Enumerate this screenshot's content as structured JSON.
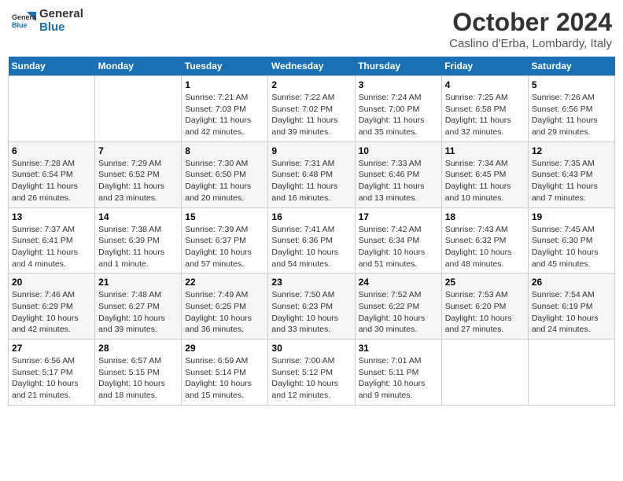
{
  "header": {
    "logo_line1": "General",
    "logo_line2": "Blue",
    "month": "October 2024",
    "location": "Caslino d'Erba, Lombardy, Italy"
  },
  "weekdays": [
    "Sunday",
    "Monday",
    "Tuesday",
    "Wednesday",
    "Thursday",
    "Friday",
    "Saturday"
  ],
  "weeks": [
    [
      {
        "day": "",
        "info": ""
      },
      {
        "day": "",
        "info": ""
      },
      {
        "day": "1",
        "info": "Sunrise: 7:21 AM\nSunset: 7:03 PM\nDaylight: 11 hours and 42 minutes."
      },
      {
        "day": "2",
        "info": "Sunrise: 7:22 AM\nSunset: 7:02 PM\nDaylight: 11 hours and 39 minutes."
      },
      {
        "day": "3",
        "info": "Sunrise: 7:24 AM\nSunset: 7:00 PM\nDaylight: 11 hours and 35 minutes."
      },
      {
        "day": "4",
        "info": "Sunrise: 7:25 AM\nSunset: 6:58 PM\nDaylight: 11 hours and 32 minutes."
      },
      {
        "day": "5",
        "info": "Sunrise: 7:26 AM\nSunset: 6:56 PM\nDaylight: 11 hours and 29 minutes."
      }
    ],
    [
      {
        "day": "6",
        "info": "Sunrise: 7:28 AM\nSunset: 6:54 PM\nDaylight: 11 hours and 26 minutes."
      },
      {
        "day": "7",
        "info": "Sunrise: 7:29 AM\nSunset: 6:52 PM\nDaylight: 11 hours and 23 minutes."
      },
      {
        "day": "8",
        "info": "Sunrise: 7:30 AM\nSunset: 6:50 PM\nDaylight: 11 hours and 20 minutes."
      },
      {
        "day": "9",
        "info": "Sunrise: 7:31 AM\nSunset: 6:48 PM\nDaylight: 11 hours and 16 minutes."
      },
      {
        "day": "10",
        "info": "Sunrise: 7:33 AM\nSunset: 6:46 PM\nDaylight: 11 hours and 13 minutes."
      },
      {
        "day": "11",
        "info": "Sunrise: 7:34 AM\nSunset: 6:45 PM\nDaylight: 11 hours and 10 minutes."
      },
      {
        "day": "12",
        "info": "Sunrise: 7:35 AM\nSunset: 6:43 PM\nDaylight: 11 hours and 7 minutes."
      }
    ],
    [
      {
        "day": "13",
        "info": "Sunrise: 7:37 AM\nSunset: 6:41 PM\nDaylight: 11 hours and 4 minutes."
      },
      {
        "day": "14",
        "info": "Sunrise: 7:38 AM\nSunset: 6:39 PM\nDaylight: 11 hours and 1 minute."
      },
      {
        "day": "15",
        "info": "Sunrise: 7:39 AM\nSunset: 6:37 PM\nDaylight: 10 hours and 57 minutes."
      },
      {
        "day": "16",
        "info": "Sunrise: 7:41 AM\nSunset: 6:36 PM\nDaylight: 10 hours and 54 minutes."
      },
      {
        "day": "17",
        "info": "Sunrise: 7:42 AM\nSunset: 6:34 PM\nDaylight: 10 hours and 51 minutes."
      },
      {
        "day": "18",
        "info": "Sunrise: 7:43 AM\nSunset: 6:32 PM\nDaylight: 10 hours and 48 minutes."
      },
      {
        "day": "19",
        "info": "Sunrise: 7:45 AM\nSunset: 6:30 PM\nDaylight: 10 hours and 45 minutes."
      }
    ],
    [
      {
        "day": "20",
        "info": "Sunrise: 7:46 AM\nSunset: 6:29 PM\nDaylight: 10 hours and 42 minutes."
      },
      {
        "day": "21",
        "info": "Sunrise: 7:48 AM\nSunset: 6:27 PM\nDaylight: 10 hours and 39 minutes."
      },
      {
        "day": "22",
        "info": "Sunrise: 7:49 AM\nSunset: 6:25 PM\nDaylight: 10 hours and 36 minutes."
      },
      {
        "day": "23",
        "info": "Sunrise: 7:50 AM\nSunset: 6:23 PM\nDaylight: 10 hours and 33 minutes."
      },
      {
        "day": "24",
        "info": "Sunrise: 7:52 AM\nSunset: 6:22 PM\nDaylight: 10 hours and 30 minutes."
      },
      {
        "day": "25",
        "info": "Sunrise: 7:53 AM\nSunset: 6:20 PM\nDaylight: 10 hours and 27 minutes."
      },
      {
        "day": "26",
        "info": "Sunrise: 7:54 AM\nSunset: 6:19 PM\nDaylight: 10 hours and 24 minutes."
      }
    ],
    [
      {
        "day": "27",
        "info": "Sunrise: 6:56 AM\nSunset: 5:17 PM\nDaylight: 10 hours and 21 minutes."
      },
      {
        "day": "28",
        "info": "Sunrise: 6:57 AM\nSunset: 5:15 PM\nDaylight: 10 hours and 18 minutes."
      },
      {
        "day": "29",
        "info": "Sunrise: 6:59 AM\nSunset: 5:14 PM\nDaylight: 10 hours and 15 minutes."
      },
      {
        "day": "30",
        "info": "Sunrise: 7:00 AM\nSunset: 5:12 PM\nDaylight: 10 hours and 12 minutes."
      },
      {
        "day": "31",
        "info": "Sunrise: 7:01 AM\nSunset: 5:11 PM\nDaylight: 10 hours and 9 minutes."
      },
      {
        "day": "",
        "info": ""
      },
      {
        "day": "",
        "info": ""
      }
    ]
  ]
}
